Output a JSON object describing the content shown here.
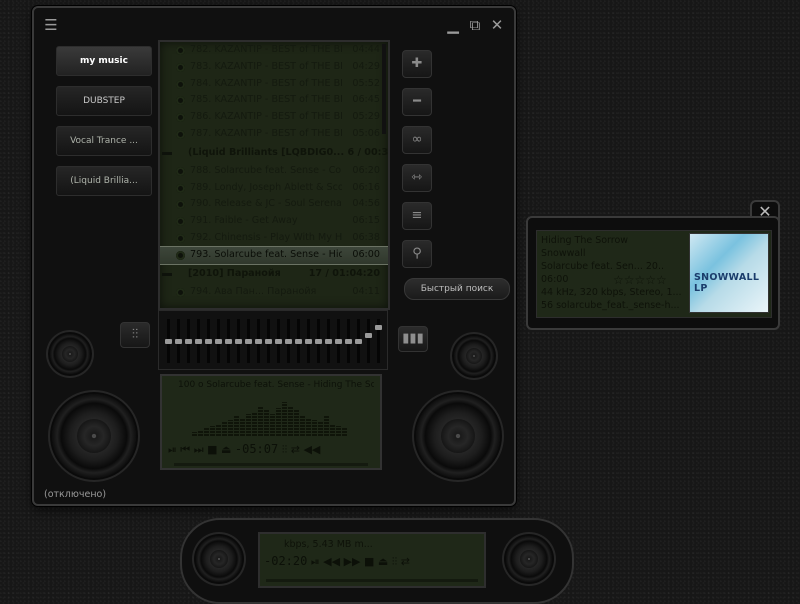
{
  "window": {
    "menu_icon": "☰",
    "minimize_icon": "▁",
    "restore_icon": "⧉",
    "close_icon": "✕",
    "status": "(отключено)"
  },
  "sidebar": {
    "items": [
      {
        "label": "my music",
        "active": true
      },
      {
        "label": "DUBSTEP"
      },
      {
        "label": "Vocal Trance ..."
      },
      {
        "label": "(Liquid Brillia..."
      }
    ]
  },
  "playlist": {
    "rows": [
      {
        "kind": "track",
        "title": "782. KAZANTIP - BEST of THE BEST",
        "duration": "04:44"
      },
      {
        "kind": "track",
        "title": "783. KAZANTIP - BEST of THE BEST",
        "duration": "04:29"
      },
      {
        "kind": "track",
        "title": "784. KAZANTIP - BEST of THE BEST",
        "duration": "05:52"
      },
      {
        "kind": "track",
        "title": "785. KAZANTIP - BEST of THE BEST",
        "duration": "06:45"
      },
      {
        "kind": "track",
        "title": "786. KAZANTIP - BEST of THE BEST",
        "duration": "05:29"
      },
      {
        "kind": "track",
        "title": "787. KAZANTIP - BEST of THE BEST",
        "duration": "05:06"
      },
      {
        "kind": "group",
        "title": "(Liquid Brilliants [LQBDIG0...  6 / 00:35:29"
      },
      {
        "kind": "track",
        "title": "788. Solarcube feat. Sense - Com",
        "duration": "06:20"
      },
      {
        "kind": "track",
        "title": "789. Londy, Joseph Ablett & Scot",
        "duration": "06:16"
      },
      {
        "kind": "track",
        "title": "790. Release & JC - Soul Serenade",
        "duration": "04:56"
      },
      {
        "kind": "track",
        "title": "791. Faible - Get Away",
        "duration": "06:15"
      },
      {
        "kind": "track",
        "title": "792. Chinensis - Play With My He",
        "duration": "06:38"
      },
      {
        "kind": "track",
        "title": "793. Solarcube feat. Sense - Hidi",
        "duration": "06:00",
        "selected": true
      },
      {
        "kind": "group",
        "title": "[2010] Паранойя",
        "stats": "17 / 01:04:20"
      },
      {
        "kind": "track",
        "title": "794. Ава Пан... Паранойя",
        "duration": "04:11"
      }
    ]
  },
  "side_buttons": [
    {
      "name": "add-icon",
      "glyph": "✚"
    },
    {
      "name": "remove-icon",
      "glyph": "━"
    },
    {
      "name": "shuffle-icon",
      "glyph": "∞"
    },
    {
      "name": "split-icon",
      "glyph": "⇿"
    },
    {
      "name": "list-icon",
      "glyph": "≡"
    },
    {
      "name": "zoom-icon",
      "glyph": "⚲"
    }
  ],
  "search": {
    "label": "Быстрый поиск"
  },
  "eq": {
    "left_icon": "⫶⫶",
    "right_icon": "▮▮▮",
    "levels": [
      0.5,
      0.5,
      0.5,
      0.5,
      0.5,
      0.5,
      0.5,
      0.5,
      0.5,
      0.5,
      0.5,
      0.5,
      0.5,
      0.5,
      0.5,
      0.5,
      0.5,
      0.5,
      0.5,
      0.5,
      0.65,
      0.85
    ]
  },
  "display": {
    "now_playing": "100 o Solarcube feat. Sense - Hiding The So",
    "controls": "⏯ ⏮ ⏭ ■ ⏏",
    "time": "-05:07",
    "extra": "⫶⫶ ⇄ ◀◀",
    "spectrum": [
      4,
      6,
      8,
      10,
      12,
      14,
      16,
      20,
      18,
      22,
      24,
      30,
      26,
      22,
      28,
      34,
      30,
      26,
      20,
      18,
      16,
      14,
      20,
      12,
      10,
      8
    ]
  },
  "popup": {
    "close": "✕",
    "line1": "Hiding The Sorrow",
    "line2": "Snowwall",
    "line3": "Solarcube feat. Sen...  20..",
    "line4": "06:00",
    "stars": "☆☆☆☆☆",
    "line5": "44 kHz, 320 kbps, Stereo, 1...",
    "line6": "56 solarcube_feat._sense-h...",
    "cover_title": "SNOWWALL LP"
  },
  "mini": {
    "info": "kbps, 5.43 MB m...",
    "time": "-02:20",
    "controls": "⏯ ◀◀ ▶▶ ■ ⏏ ⫶⫶ ⇄"
  }
}
